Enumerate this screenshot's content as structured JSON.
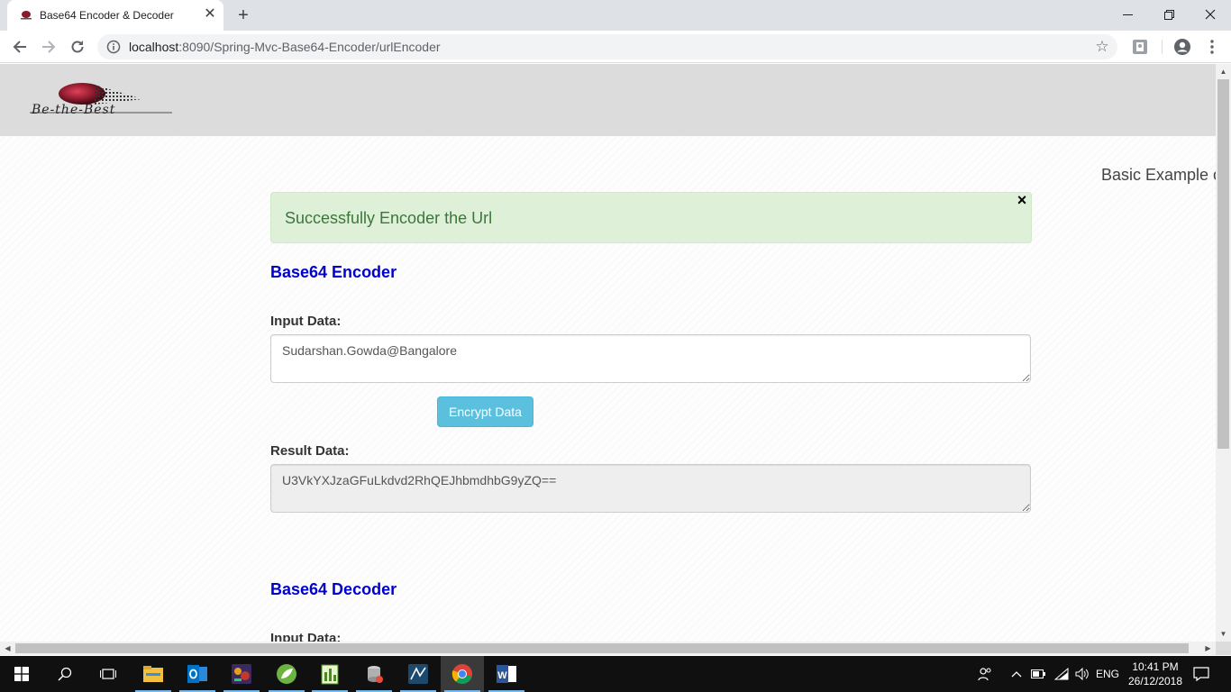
{
  "browser": {
    "tab_title": "Base64 Encoder & Decoder",
    "tab_close": "✕",
    "new_tab": "+",
    "url_host": "localhost",
    "url_rest": ":8090/Spring-Mvc-Base64-Encoder/urlEncoder",
    "star": "☆"
  },
  "page": {
    "logo_text": "Be-the-Best",
    "marquee": "Basic Example o",
    "alert": {
      "message": "Successfully Encoder the Url",
      "close": "×"
    },
    "encoder": {
      "title": "Base64 Encoder",
      "input_label": "Input Data:",
      "input_value": "Sudarshan.Gowda@Bangalore",
      "button_label": "Encrypt Data",
      "result_label": "Result Data:",
      "result_value": "U3VkYXJzaGFuLkdvd2RhQEJhbmdhbG9yZQ=="
    },
    "decoder": {
      "title": "Base64 Decoder",
      "input_label": "Input Data:"
    }
  },
  "taskbar": {
    "language": "ENG",
    "time": "10:41 PM",
    "date": "26/12/2018"
  },
  "colors": {
    "section_title": "#0000cd",
    "alert_bg": "#dff0d8",
    "alert_text": "#3c763d",
    "button_bg": "#5bc0de",
    "header_band": "#dcdcdc"
  }
}
